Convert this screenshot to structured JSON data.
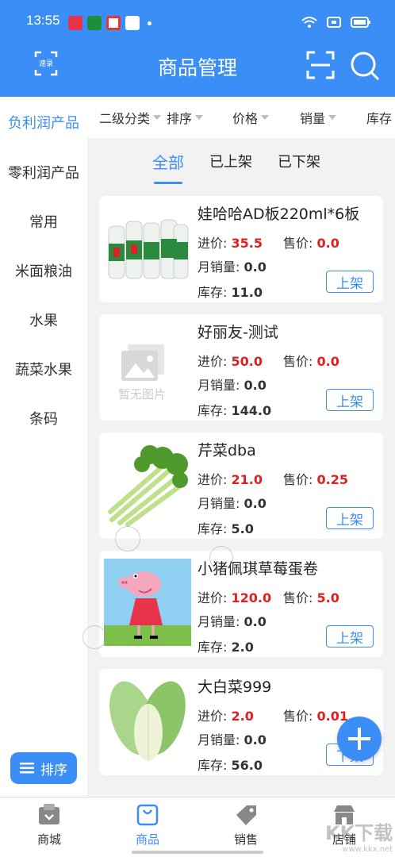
{
  "status_bar": {
    "time": "13:55"
  },
  "header": {
    "title": "商品管理",
    "left_icon_label": "速录"
  },
  "sidebar": {
    "items": [
      {
        "label": "负利润产品",
        "active": true
      },
      {
        "label": "零利润产品"
      },
      {
        "label": "常用"
      },
      {
        "label": "米面粮油"
      },
      {
        "label": "水果"
      },
      {
        "label": "蔬菜水果"
      },
      {
        "label": "条码"
      }
    ],
    "sort_button": "排序"
  },
  "filters": [
    "二级分类",
    "排序",
    "价格",
    "销量",
    "库存"
  ],
  "tabs": [
    {
      "label": "全部",
      "active": true
    },
    {
      "label": "已上架"
    },
    {
      "label": "已下架"
    }
  ],
  "labels": {
    "cost": "进价: ",
    "sale": "售价: ",
    "monthly_sales": "月销量: ",
    "stock": "库存: ",
    "no_image": "暂无图片"
  },
  "products": [
    {
      "name": "娃哈哈AD板220ml*6板",
      "cost": "35.5",
      "price": "0.0",
      "monthly_sales": "0.0",
      "stock": "11.0",
      "action": "上架"
    },
    {
      "name": "好丽友-测试",
      "cost": "50.0",
      "price": "0.0",
      "monthly_sales": "0.0",
      "stock": "144.0",
      "action": "上架"
    },
    {
      "name": "芹菜dba",
      "cost": "21.0",
      "price": "0.25",
      "monthly_sales": "0.0",
      "stock": "5.0",
      "action": "上架"
    },
    {
      "name": "小猪佩琪草莓蛋卷",
      "cost": "120.0",
      "price": "5.0",
      "monthly_sales": "0.0",
      "stock": "2.0",
      "action": "上架"
    },
    {
      "name": "大白菜999",
      "cost": "2.0",
      "price": "0.01",
      "monthly_sales": "0.0",
      "stock": "56.0",
      "action": "下架"
    }
  ],
  "bottom_tabs": [
    {
      "label": "商城"
    },
    {
      "label": "商品",
      "active": true
    },
    {
      "label": "销售"
    },
    {
      "label": "店铺"
    }
  ],
  "watermark": {
    "text": "KK下载",
    "url": "www.kkx.net"
  },
  "colors": {
    "primary": "#3b8ef6",
    "price_red": "#e02020"
  }
}
